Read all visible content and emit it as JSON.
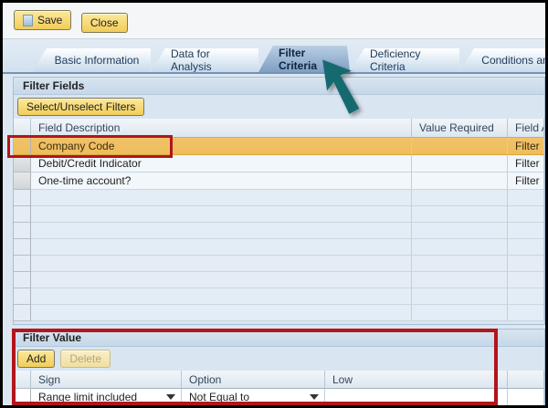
{
  "toolbar": {
    "save_label": "Save",
    "close_label": "Close"
  },
  "tabs": [
    {
      "label": "Basic Information",
      "selected": false
    },
    {
      "label": "Data for Analysis",
      "selected": false
    },
    {
      "label": "Filter Criteria",
      "selected": true
    },
    {
      "label": "Deficiency Criteria",
      "selected": false
    },
    {
      "label": "Conditions and Calcula",
      "selected": false
    }
  ],
  "filter_fields": {
    "title": "Filter Fields",
    "select_button_label": "Select/Unselect Filters",
    "columns": {
      "description": "Field Description",
      "value_required": "Value Required",
      "field_analysis": "Field An"
    },
    "rows": [
      {
        "description": "Company Code",
        "value_required": "",
        "field_analysis": "Filter",
        "selected": true
      },
      {
        "description": "Debit/Credit Indicator",
        "value_required": "",
        "field_analysis": "Filter",
        "selected": false
      },
      {
        "description": "One-time account?",
        "value_required": "",
        "field_analysis": "Filter",
        "selected": false
      }
    ],
    "empty_row_count": 8
  },
  "filter_value": {
    "title": "Filter Value",
    "add_button_label": "Add",
    "delete_button_label": "Delete",
    "columns": {
      "sign": "Sign",
      "option": "Option",
      "low": "Low"
    },
    "row": {
      "sign": "Range limit included",
      "option": "Not Equal to",
      "low": ""
    }
  },
  "annotations": {
    "highlight_color": "#b2151b",
    "arrow_color": "#156a70"
  }
}
